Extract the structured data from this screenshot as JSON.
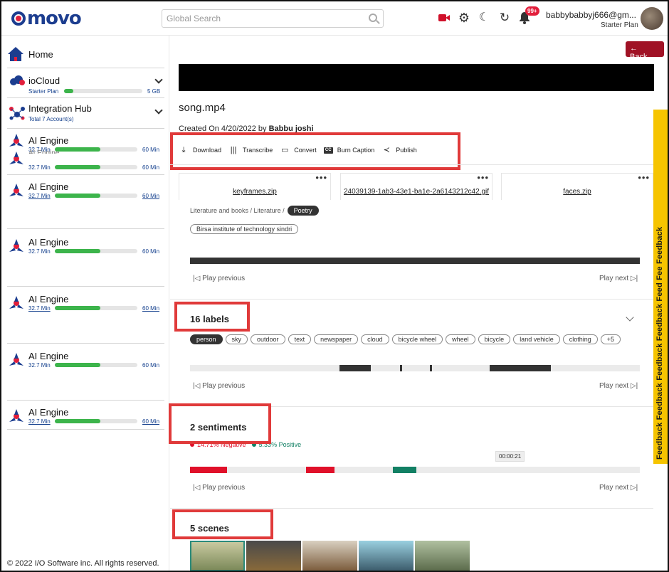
{
  "header": {
    "logo": "movo",
    "search_placeholder": "Global Search",
    "notifications_badge": "99+",
    "user_email": "babbybabbyj666@gm...",
    "user_plan": "Starter Plan"
  },
  "sidebar": {
    "home": "Home",
    "iocloud": {
      "title": "ioCloud",
      "sub": "Starter Plan",
      "storage": "5 GB",
      "progress": 0.12
    },
    "hub": {
      "title": "Integration Hub",
      "sub": "Total 7 Account(s)"
    },
    "engines": [
      {
        "title": "AI Engine",
        "used": "32.7 Min",
        "total": "60 Min",
        "progress": 0.55
      },
      {
        "title": "AI Engine",
        "used": "32.7 Min",
        "total": "60 Min",
        "progress": 0.55
      },
      {
        "title": "AI Engine",
        "used": "32.7 Min",
        "total": "60 Min",
        "progress": 0.55
      },
      {
        "title": "AI Engine",
        "used": "32.7 Min",
        "total": "60 Min",
        "progress": 0.55
      },
      {
        "title": "AI Engine",
        "used": "32.7 Min",
        "total": "60 Min",
        "progress": 0.55
      },
      {
        "title": "AI Engine",
        "used": "32.7 Min",
        "total": "60 Min",
        "progress": 0.55
      },
      {
        "title": "AI Engine",
        "used": "32.7 Min",
        "total": "60 Min",
        "progress": 0.55
      }
    ],
    "footer": "© 2022 I/O Software inc. All rights reserved."
  },
  "main": {
    "back": "Back",
    "file_title": "song.mp4",
    "created_prefix": "Created On 4/20/2022 by ",
    "created_by": "Babbu joshi",
    "actions": {
      "download": "Download",
      "transcribe": "Transcribe",
      "convert": "Convert",
      "burn_caption": "Burn Caption",
      "publish": "Publish"
    },
    "files": [
      "keyframes.zip",
      "24039139-1ab3-43e1-ba1e-2a6143212c42.gif",
      "faces.zip"
    ],
    "crumb_path": "Literature and books / Literature /",
    "crumb_active": "Poetry",
    "org": "Birsa institute of technology sindri",
    "play_previous": "Play previous",
    "play_next": "Play next",
    "labels_title": "16 labels",
    "labels": [
      "person",
      "sky",
      "outdoor",
      "text",
      "newspaper",
      "cloud",
      "bicycle wheel",
      "wheel",
      "bicycle",
      "land vehicle",
      "clothing",
      "+5"
    ],
    "sentiments_title": "2 sentiments",
    "negative": "14.71% Negative",
    "positive": "5.33% Positive",
    "tooltip": "00:00:21",
    "scenes_title": "5 scenes"
  },
  "feedback": "Feedback Feedback Feedback Feedback Feed Fee Feedback",
  "colors": {
    "accent": "#1c3d8f",
    "brand_red": "#e21f3c",
    "progress": "#3cb44b",
    "back_button": "#a01225",
    "feedback_tab": "#f6c400",
    "negative": "#e0102a",
    "positive": "#128064"
  }
}
